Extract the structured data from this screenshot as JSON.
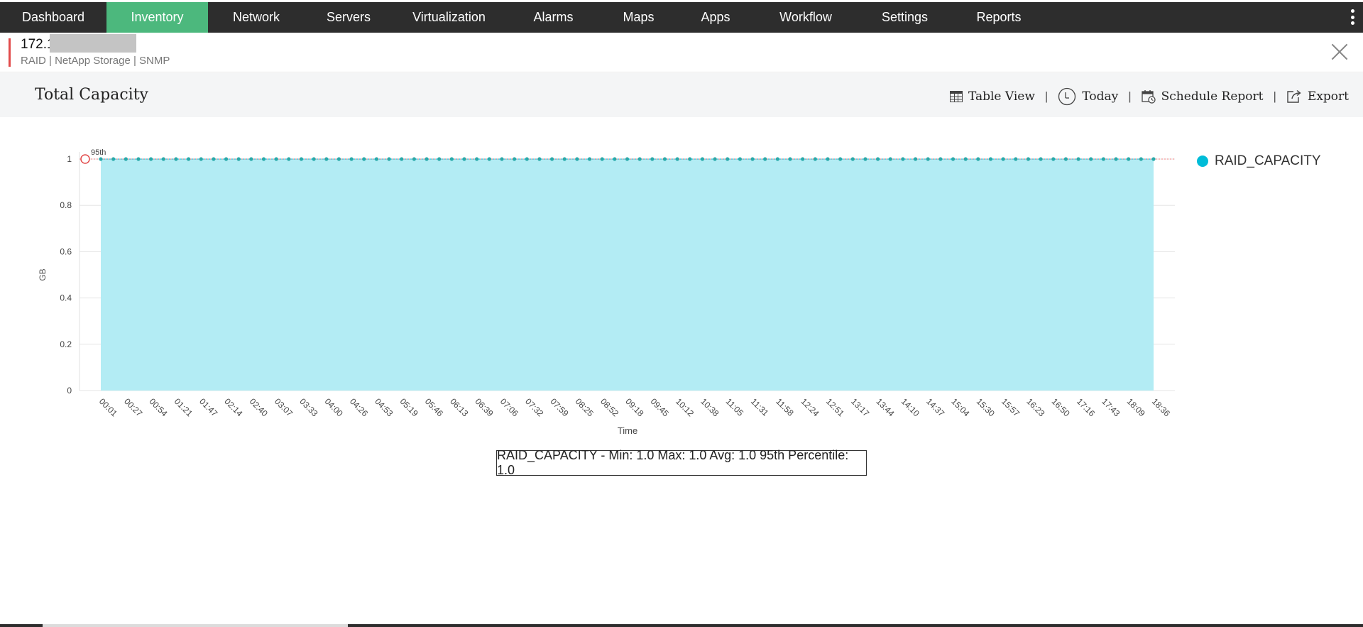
{
  "nav": {
    "items": [
      {
        "label": "Dashboard",
        "w": 150
      },
      {
        "label": "Inventory",
        "w": 143,
        "active": true
      },
      {
        "label": "Network",
        "w": 136
      },
      {
        "label": "Servers",
        "w": 124
      },
      {
        "label": "Virtualization",
        "w": 159
      },
      {
        "label": "Alarms",
        "w": 135
      },
      {
        "label": "Maps",
        "w": 105
      },
      {
        "label": "Apps",
        "w": 112
      },
      {
        "label": "Workflow",
        "w": 142
      },
      {
        "label": "Settings",
        "w": 137
      },
      {
        "label": "Reports",
        "w": 128
      }
    ]
  },
  "device": {
    "ip": "172.1",
    "meta": "RAID | NetApp Storage  | SNMP"
  },
  "page": {
    "title": "Total Capacity"
  },
  "actions": {
    "table_view": "Table View",
    "today": "Today",
    "schedule": "Schedule Report",
    "export": "Export"
  },
  "legend": {
    "label": "RAID_CAPACITY",
    "color": "#00bcd8"
  },
  "stats": "RAID_CAPACITY - Min: 1.0 Max: 1.0 Avg: 1.0 95th Percentile: 1.0",
  "chart_data": {
    "type": "area",
    "title": "",
    "xlabel": "Time",
    "ylabel": "GB",
    "ylim": [
      0,
      1
    ],
    "yticks": [
      0,
      0.2,
      0.4,
      0.6,
      0.8,
      1
    ],
    "x": [
      "00:01",
      "00:27",
      "00:54",
      "01:21",
      "01:47",
      "02:14",
      "02:40",
      "03:07",
      "03:33",
      "04:00",
      "04:26",
      "04:53",
      "05:19",
      "05:46",
      "06:13",
      "06:39",
      "07:06",
      "07:32",
      "07:59",
      "08:25",
      "08:52",
      "09:18",
      "09:45",
      "10:12",
      "10:38",
      "11:05",
      "11:31",
      "11:58",
      "12:24",
      "12:51",
      "13:17",
      "13:44",
      "14:10",
      "14:37",
      "15:04",
      "15:30",
      "15:57",
      "16:23",
      "16:50",
      "17:16",
      "17:43",
      "18:09",
      "18:36"
    ],
    "series": [
      {
        "name": "RAID_CAPACITY",
        "value": 1,
        "color": "#00bcd8",
        "fill": "#b3ecf4"
      }
    ],
    "percentile_label": "95th",
    "percentile_value": 1,
    "grid": true,
    "legend_position": "right"
  }
}
